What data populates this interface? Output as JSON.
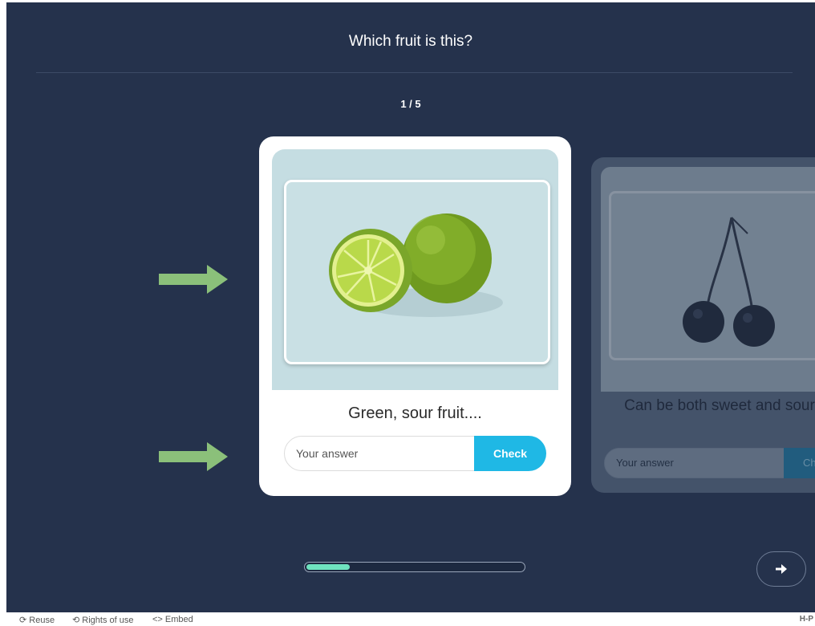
{
  "quiz": {
    "title": "Which fruit is this?",
    "progress_text": "1 / 5",
    "progress_fraction": 0.2
  },
  "current_card": {
    "image_icon": "lime-image",
    "clue": "Green, sour fruit....",
    "answer_placeholder": "Your answer",
    "check_label": "Check"
  },
  "next_card": {
    "image_icon": "cherries-image",
    "clue": "Can be both sweet and sour....",
    "answer_placeholder": "Your answer",
    "check_label": "Ch"
  },
  "navigation": {
    "next_icon": "arrow-right-icon"
  },
  "footer": {
    "reuse_label": "Reuse",
    "rights_label": "Rights of use",
    "embed_label": "Embed",
    "brand": "H-P"
  },
  "colors": {
    "background": "#25324c",
    "check_button": "#1fb8e5",
    "progress_fill": "#6fe3bf",
    "annotation_arrow": "#8bc07a"
  }
}
